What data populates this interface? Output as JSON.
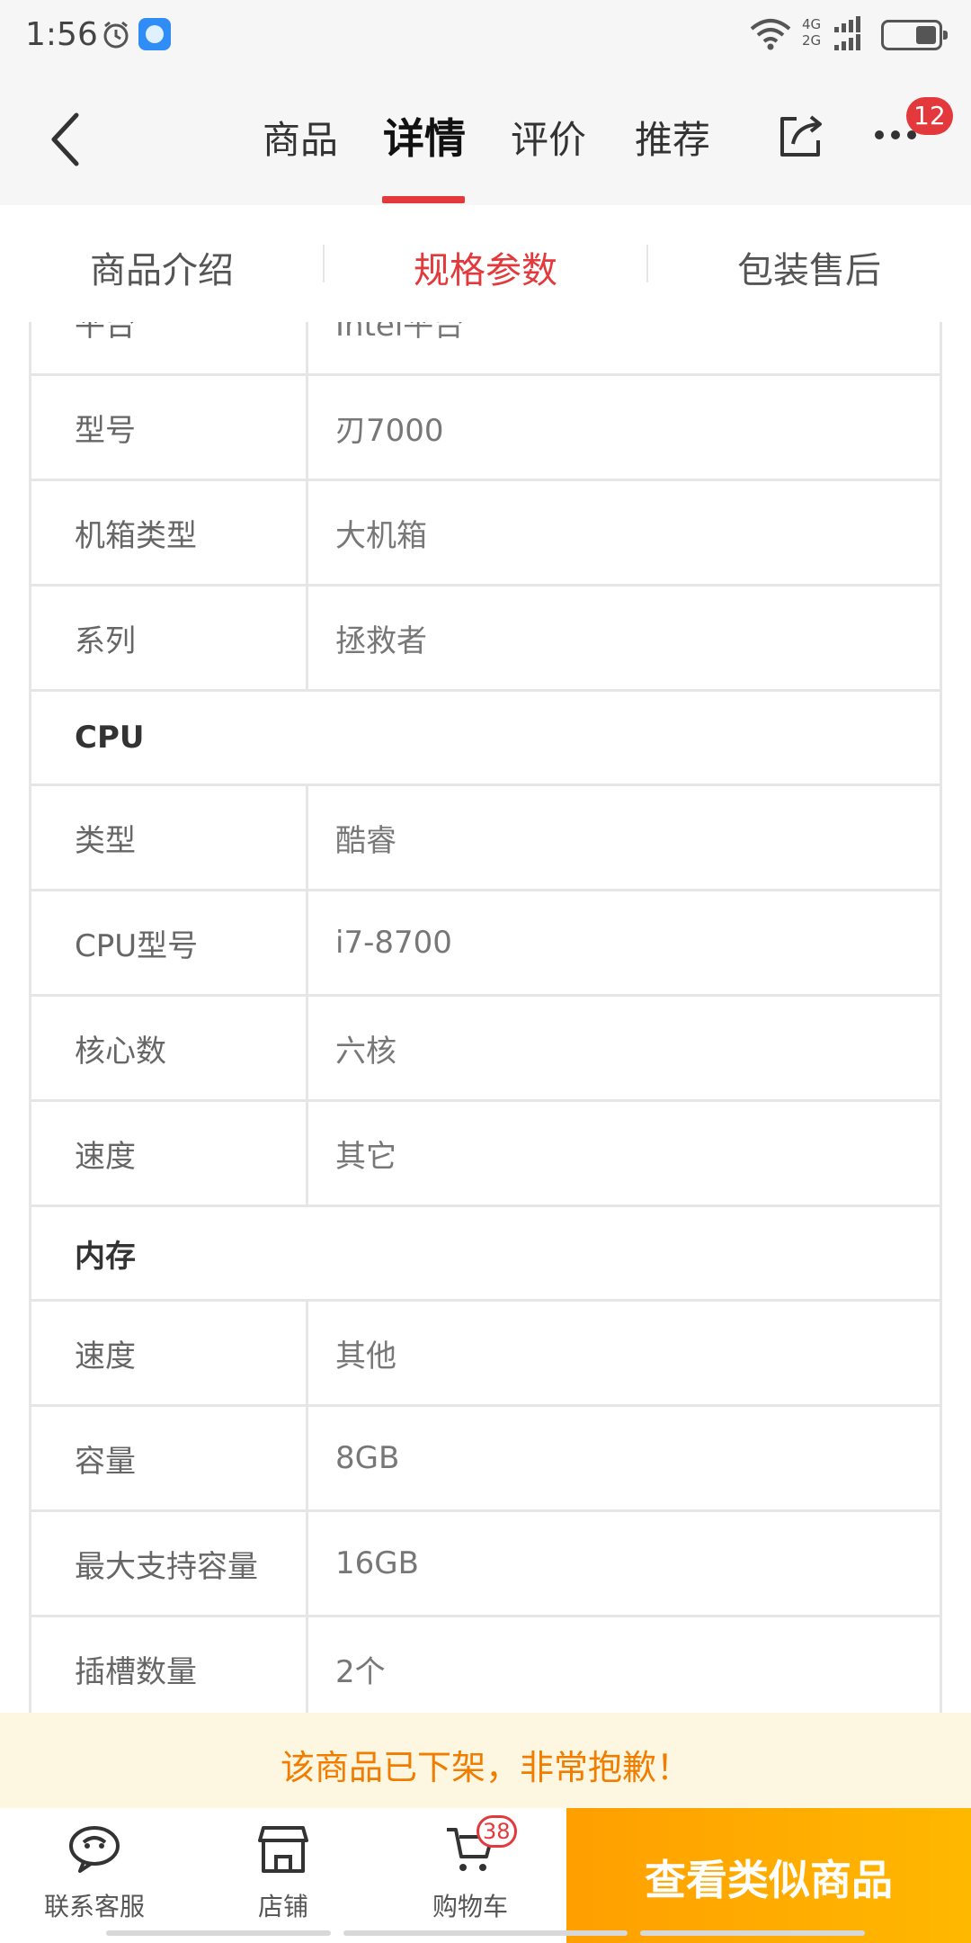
{
  "status_bar": {
    "time": "1:56",
    "network_top": "4G",
    "network_bottom": "2G",
    "icons": [
      "alarm-icon",
      "app-notification-icon",
      "wifi-icon",
      "signal-icon",
      "battery-icon"
    ]
  },
  "header": {
    "tabs": [
      {
        "label": "商品",
        "active": false
      },
      {
        "label": "详情",
        "active": true
      },
      {
        "label": "评价",
        "active": false
      },
      {
        "label": "推荐",
        "active": false
      }
    ],
    "more_badge": "12",
    "accent_color": "#e4393c"
  },
  "subtabs": [
    {
      "label": "商品介绍",
      "active": false
    },
    {
      "label": "规格参数",
      "active": true
    },
    {
      "label": "包装售后",
      "active": false
    }
  ],
  "specs": {
    "rows_top": [
      {
        "key": "平台",
        "value": "Intel平台"
      },
      {
        "key": "型号",
        "value": "刃7000"
      },
      {
        "key": "机箱类型",
        "value": "大机箱"
      },
      {
        "key": "系列",
        "value": "拯救者"
      }
    ],
    "section_cpu": "CPU",
    "rows_cpu": [
      {
        "key": "类型",
        "value": "酷睿"
      },
      {
        "key": "CPU型号",
        "value": "i7-8700"
      },
      {
        "key": "核心数",
        "value": "六核"
      },
      {
        "key": "速度",
        "value": "其它"
      }
    ],
    "section_memory": "内存",
    "rows_memory": [
      {
        "key": "速度",
        "value": "其他"
      },
      {
        "key": "容量",
        "value": "8GB"
      },
      {
        "key": "最大支持容量",
        "value": "16GB"
      },
      {
        "key": "插槽数量",
        "value": "2个"
      }
    ]
  },
  "notice": {
    "text": "该商品已下架，非常抱歉！",
    "color": "#f07d00"
  },
  "bottom_bar": {
    "customer_service": "联系客服",
    "shop": "店铺",
    "cart": "购物车",
    "cart_badge": "38",
    "similar_button": "查看类似商品",
    "button_color": "#ffa800"
  }
}
